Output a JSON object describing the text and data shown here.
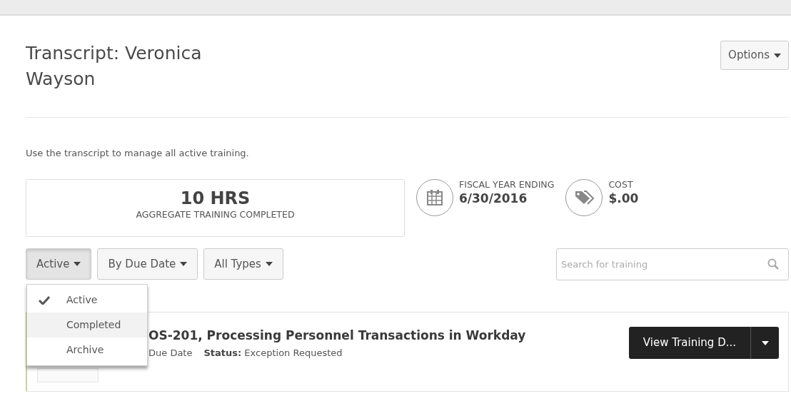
{
  "header": {
    "title": "Transcript: Veronica Wayson",
    "options_button": "Options"
  },
  "intro": "Use the transcript to manage all active training.",
  "stats": {
    "hours": "10 HRS",
    "hours_label": "AGGREGATE TRAINING COMPLETED",
    "fiscal_label": "FISCAL YEAR ENDING",
    "fiscal_value": "6/30/2016",
    "cost_label": "COST",
    "cost_value": "$.00"
  },
  "filters": [
    {
      "label": "Active",
      "expanded": true
    },
    {
      "label": "By Due Date",
      "expanded": false
    },
    {
      "label": "All Types",
      "expanded": false
    }
  ],
  "status_menu": [
    {
      "label": "Active",
      "selected": true,
      "hovered": false
    },
    {
      "label": "Completed",
      "selected": false,
      "hovered": true
    },
    {
      "label": "Archive",
      "selected": false,
      "hovered": false
    }
  ],
  "search": {
    "placeholder": "Search for training"
  },
  "training": {
    "title": "OS-201, Processing Personnel Transactions in Workday",
    "due": "Due Date",
    "status": "**Status:** Exception Requested",
    "action": "View Training D..."
  }
}
